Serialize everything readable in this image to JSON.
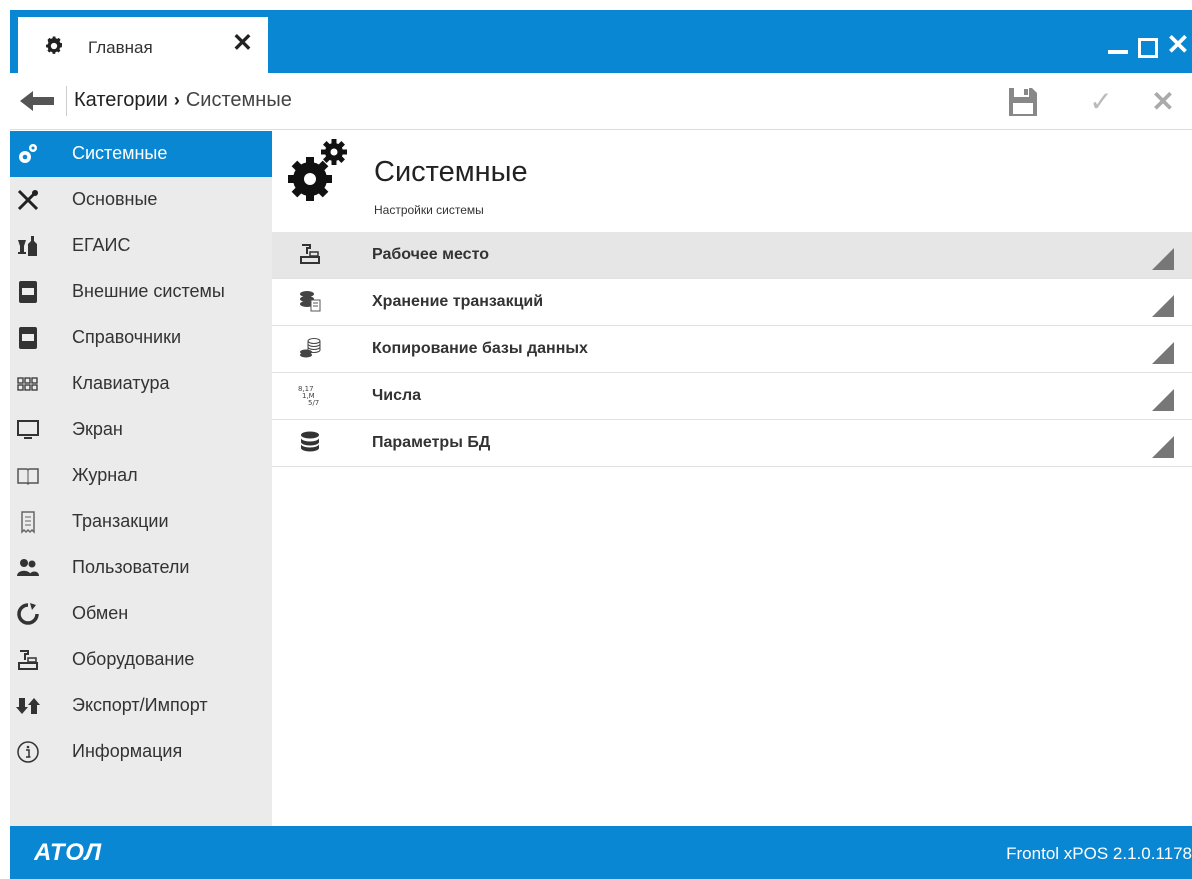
{
  "window": {
    "tab_label": "Главная"
  },
  "navbar": {
    "crumb_category": "Категории",
    "crumb_current": "Системные"
  },
  "sidebar": {
    "items": [
      {
        "label": "Системные",
        "icon": "gears-icon",
        "active": true
      },
      {
        "label": "Основные",
        "icon": "tools-icon"
      },
      {
        "label": "ЕГАИС",
        "icon": "bottles-icon"
      },
      {
        "label": "Внешние системы",
        "icon": "book-icon"
      },
      {
        "label": "Справочники",
        "icon": "book-icon"
      },
      {
        "label": "Клавиатура",
        "icon": "keyboard-icon"
      },
      {
        "label": "Экран",
        "icon": "monitor-icon"
      },
      {
        "label": "Журнал",
        "icon": "open-book-icon"
      },
      {
        "label": "Транзакции",
        "icon": "receipt-icon"
      },
      {
        "label": "Пользователи",
        "icon": "users-icon"
      },
      {
        "label": "Обмен",
        "icon": "sync-icon"
      },
      {
        "label": "Оборудование",
        "icon": "cash-register-icon"
      },
      {
        "label": "Экспорт/Импорт",
        "icon": "export-import-icon"
      },
      {
        "label": "Информация",
        "icon": "info-icon"
      }
    ]
  },
  "main": {
    "title": "Системные",
    "subtitle": "Настройки системы",
    "rows": [
      {
        "label": "Рабочее место",
        "icon": "cash-register-icon",
        "selected": true
      },
      {
        "label": "Хранение транзакций",
        "icon": "coins-receipt-icon"
      },
      {
        "label": "Копирование базы данных",
        "icon": "db-copy-icon"
      },
      {
        "label": "Числа",
        "icon": "numbers-icon"
      },
      {
        "label": "Параметры БД",
        "icon": "database-icon"
      }
    ]
  },
  "footer": {
    "brand": "АТОЛ",
    "version": "Frontol xPOS 2.1.0.1178"
  },
  "colors": {
    "accent": "#0a87d2",
    "sidebar_bg": "#ebebeb",
    "selected_row": "#e6e6e6"
  }
}
